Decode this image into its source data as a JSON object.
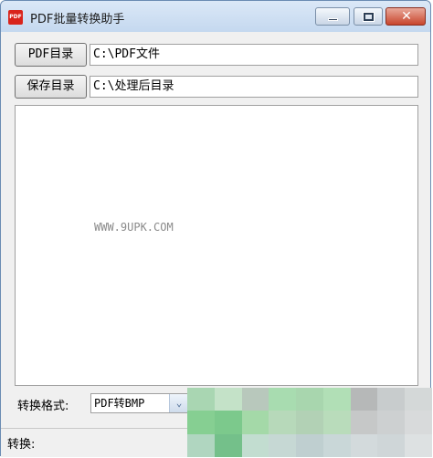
{
  "window": {
    "title": "PDF批量转换助手",
    "icon_text": "PDF",
    "close_glyph": "✕"
  },
  "pdf_dir": {
    "button_label": "PDF目录",
    "path": "C:\\PDF文件"
  },
  "save_dir": {
    "button_label": "保存目录",
    "path": "C:\\处理后目录"
  },
  "log": {
    "watermark": "WWW.9UPK.COM"
  },
  "format": {
    "label": "转换格式:",
    "selected": "PDF转BMP",
    "arrow": "⌄"
  },
  "status": {
    "label": "转换:"
  },
  "mosaic_colors": [
    "#a9d6b2",
    "#c4e2c8",
    "#b8c8bc",
    "#a8dcb0",
    "#a8d6ae",
    "#b1dfb6",
    "#b6b8b8",
    "#c8cccd",
    "#d4d8d8",
    "#86cf92",
    "#7cc98c",
    "#a4d9a8",
    "#b7d9ba",
    "#b2d1b5",
    "#b9dcbb",
    "#c6c8c8",
    "#cdd0d1",
    "#d8dadb",
    "#b0d6c0",
    "#74c08a",
    "#c2ddd0",
    "#c6d8d4",
    "#bfcfd0",
    "#c9d7d8",
    "#d3dadc",
    "#cfd6d8",
    "#dde1e2"
  ]
}
